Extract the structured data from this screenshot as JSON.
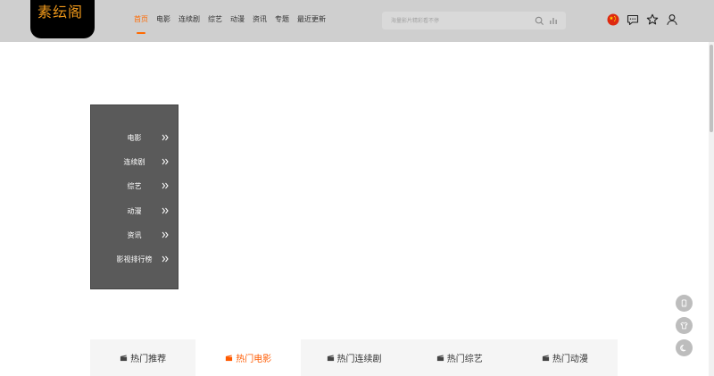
{
  "header": {
    "logo_text": "素纭阁",
    "nav": [
      {
        "label": "首页",
        "active": true
      },
      {
        "label": "电影",
        "active": false
      },
      {
        "label": "连续剧",
        "active": false
      },
      {
        "label": "综艺",
        "active": false
      },
      {
        "label": "动漫",
        "active": false
      },
      {
        "label": "资讯",
        "active": false
      },
      {
        "label": "专题",
        "active": false
      },
      {
        "label": "最近更新",
        "active": false
      }
    ],
    "search": {
      "placeholder": "海量影片精彩看不停",
      "value": ""
    },
    "icons": [
      "search-icon",
      "hot-chart-icon",
      "china-flag-icon",
      "message-icon",
      "star-icon",
      "user-icon"
    ]
  },
  "sidemenu": {
    "items": [
      "电影",
      "连续剧",
      "综艺",
      "动漫",
      "资讯",
      "影视排行榜"
    ]
  },
  "floating": [
    "mobile-icon",
    "shirt-icon",
    "moon-icon"
  ],
  "tabs": [
    {
      "label": "热门推荐",
      "active": false
    },
    {
      "label": "热门电影",
      "active": true
    },
    {
      "label": "热门连续剧",
      "active": false
    },
    {
      "label": "热门综艺",
      "active": false
    },
    {
      "label": "热门动漫",
      "active": false
    }
  ],
  "colors": {
    "accent": "#ff6a00",
    "header_bg": "#cfcfcf",
    "menu_bg": "#5a5a5a"
  }
}
